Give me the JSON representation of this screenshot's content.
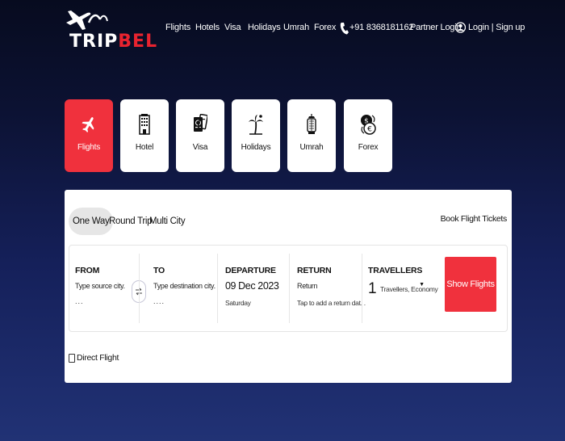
{
  "brand": {
    "logo_text_white": "TRIP",
    "logo_text_red": "BEL"
  },
  "nav": {
    "items": [
      "Flights",
      "Hotels",
      "Visa",
      "Holidays",
      "Umrah",
      "Forex"
    ],
    "phone": "+91 8368181162",
    "partner_login": "Partner Login",
    "login_signup": "Login | Sign up"
  },
  "services": {
    "tiles": [
      {
        "label": "Flights",
        "icon": "airplane-icon",
        "active": true
      },
      {
        "label": "Hotel",
        "icon": "hotel-building-icon",
        "active": false
      },
      {
        "label": "Visa",
        "icon": "passport-icon",
        "active": false
      },
      {
        "label": "Holidays",
        "icon": "palm-tree-icon",
        "active": false
      },
      {
        "label": "Umrah",
        "icon": "lantern-icon",
        "active": false
      },
      {
        "label": "Forex",
        "icon": "currency-exchange-icon",
        "active": false
      }
    ]
  },
  "search": {
    "trip_types": [
      "One Way",
      "Round Trip",
      "Multi City"
    ],
    "active_trip_type": "One Way",
    "book_link": "Book Flight Tickets",
    "from": {
      "label": "FROM",
      "placeholder": "Type source city.",
      "dots": "...",
      "value": ""
    },
    "to": {
      "label": "TO",
      "placeholder": "Type destination city.",
      "dots": "....",
      "value": ""
    },
    "departure": {
      "label": "DEPARTURE",
      "date": "09 Dec 2023",
      "day": "Saturday"
    },
    "return": {
      "label": "RETURN",
      "value": "Return",
      "hint": "Tap to add a return dat. ."
    },
    "travellers": {
      "label": "TRAVELLERS",
      "count": "1",
      "text": "Travellers, Economy"
    },
    "submit_label": "Show Flights",
    "direct_flight_label": "Direct Flight",
    "direct_flight_checked": false
  },
  "colors": {
    "accent": "#f0313d",
    "background_top": "#070b1f",
    "background_bottom": "#213275"
  }
}
